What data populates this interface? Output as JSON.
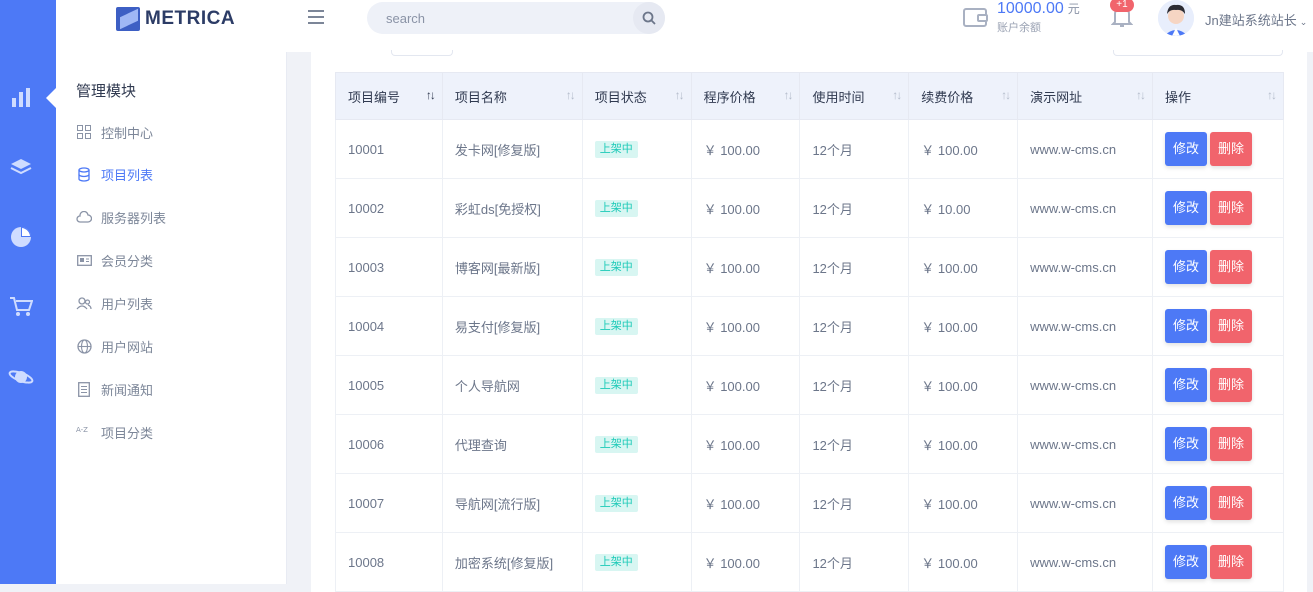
{
  "brand": {
    "name": "METRICA"
  },
  "search": {
    "placeholder": "search"
  },
  "account": {
    "balance": "10000.00",
    "unit": "元",
    "balance_label": "账户余额",
    "notifications": "+1",
    "user_name": "Jn建站系统站长"
  },
  "rail": {
    "icons": [
      "bar-chart-icon",
      "layers-icon",
      "pie-chart-icon",
      "cart-icon",
      "planet-icon"
    ]
  },
  "menu": {
    "title": "管理模块",
    "items": [
      {
        "label": "控制中心",
        "icon": "grid-icon"
      },
      {
        "label": "项目列表",
        "icon": "database-icon"
      },
      {
        "label": "服务器列表",
        "icon": "cloud-icon"
      },
      {
        "label": "会员分类",
        "icon": "id-card-icon"
      },
      {
        "label": "用户列表",
        "icon": "users-icon"
      },
      {
        "label": "用户网站",
        "icon": "globe-icon"
      },
      {
        "label": "新闻通知",
        "icon": "document-icon"
      },
      {
        "label": "项目分类",
        "icon": "az-sort-icon"
      }
    ],
    "active_index": 1
  },
  "table": {
    "columns": [
      "项目编号",
      "项目名称",
      "项目状态",
      "程序价格",
      "使用时间",
      "续费价格",
      "演示网址",
      "操作"
    ],
    "edit_label": "修改",
    "delete_label": "删除",
    "rows": [
      {
        "id": "10001",
        "name": "发卡网[修复版]",
        "status": "上架中",
        "price": "￥ 100.00",
        "duration": "12个月",
        "renew": "￥ 100.00",
        "url": "www.w-cms.cn"
      },
      {
        "id": "10002",
        "name": "彩虹ds[免授权]",
        "status": "上架中",
        "price": "￥ 100.00",
        "duration": "12个月",
        "renew": "￥ 10.00",
        "url": "www.w-cms.cn"
      },
      {
        "id": "10003",
        "name": "博客网[最新版]",
        "status": "上架中",
        "price": "￥ 100.00",
        "duration": "12个月",
        "renew": "￥ 100.00",
        "url": "www.w-cms.cn"
      },
      {
        "id": "10004",
        "name": "易支付[修复版]",
        "status": "上架中",
        "price": "￥ 100.00",
        "duration": "12个月",
        "renew": "￥ 100.00",
        "url": "www.w-cms.cn"
      },
      {
        "id": "10005",
        "name": "个人导航网",
        "status": "上架中",
        "price": "￥ 100.00",
        "duration": "12个月",
        "renew": "￥ 100.00",
        "url": "www.w-cms.cn"
      },
      {
        "id": "10006",
        "name": "代理查询",
        "status": "上架中",
        "price": "￥ 100.00",
        "duration": "12个月",
        "renew": "￥ 100.00",
        "url": "www.w-cms.cn"
      },
      {
        "id": "10007",
        "name": "导航网[流行版]",
        "status": "上架中",
        "price": "￥ 100.00",
        "duration": "12个月",
        "renew": "￥ 100.00",
        "url": "www.w-cms.cn"
      },
      {
        "id": "10008",
        "name": "加密系统[修复版]",
        "status": "上架中",
        "price": "￥ 100.00",
        "duration": "12个月",
        "renew": "￥ 100.00",
        "url": "www.w-cms.cn"
      }
    ]
  },
  "colors": {
    "primary": "#4d79f6",
    "danger": "#f1646c",
    "success": "#1ecab8"
  }
}
